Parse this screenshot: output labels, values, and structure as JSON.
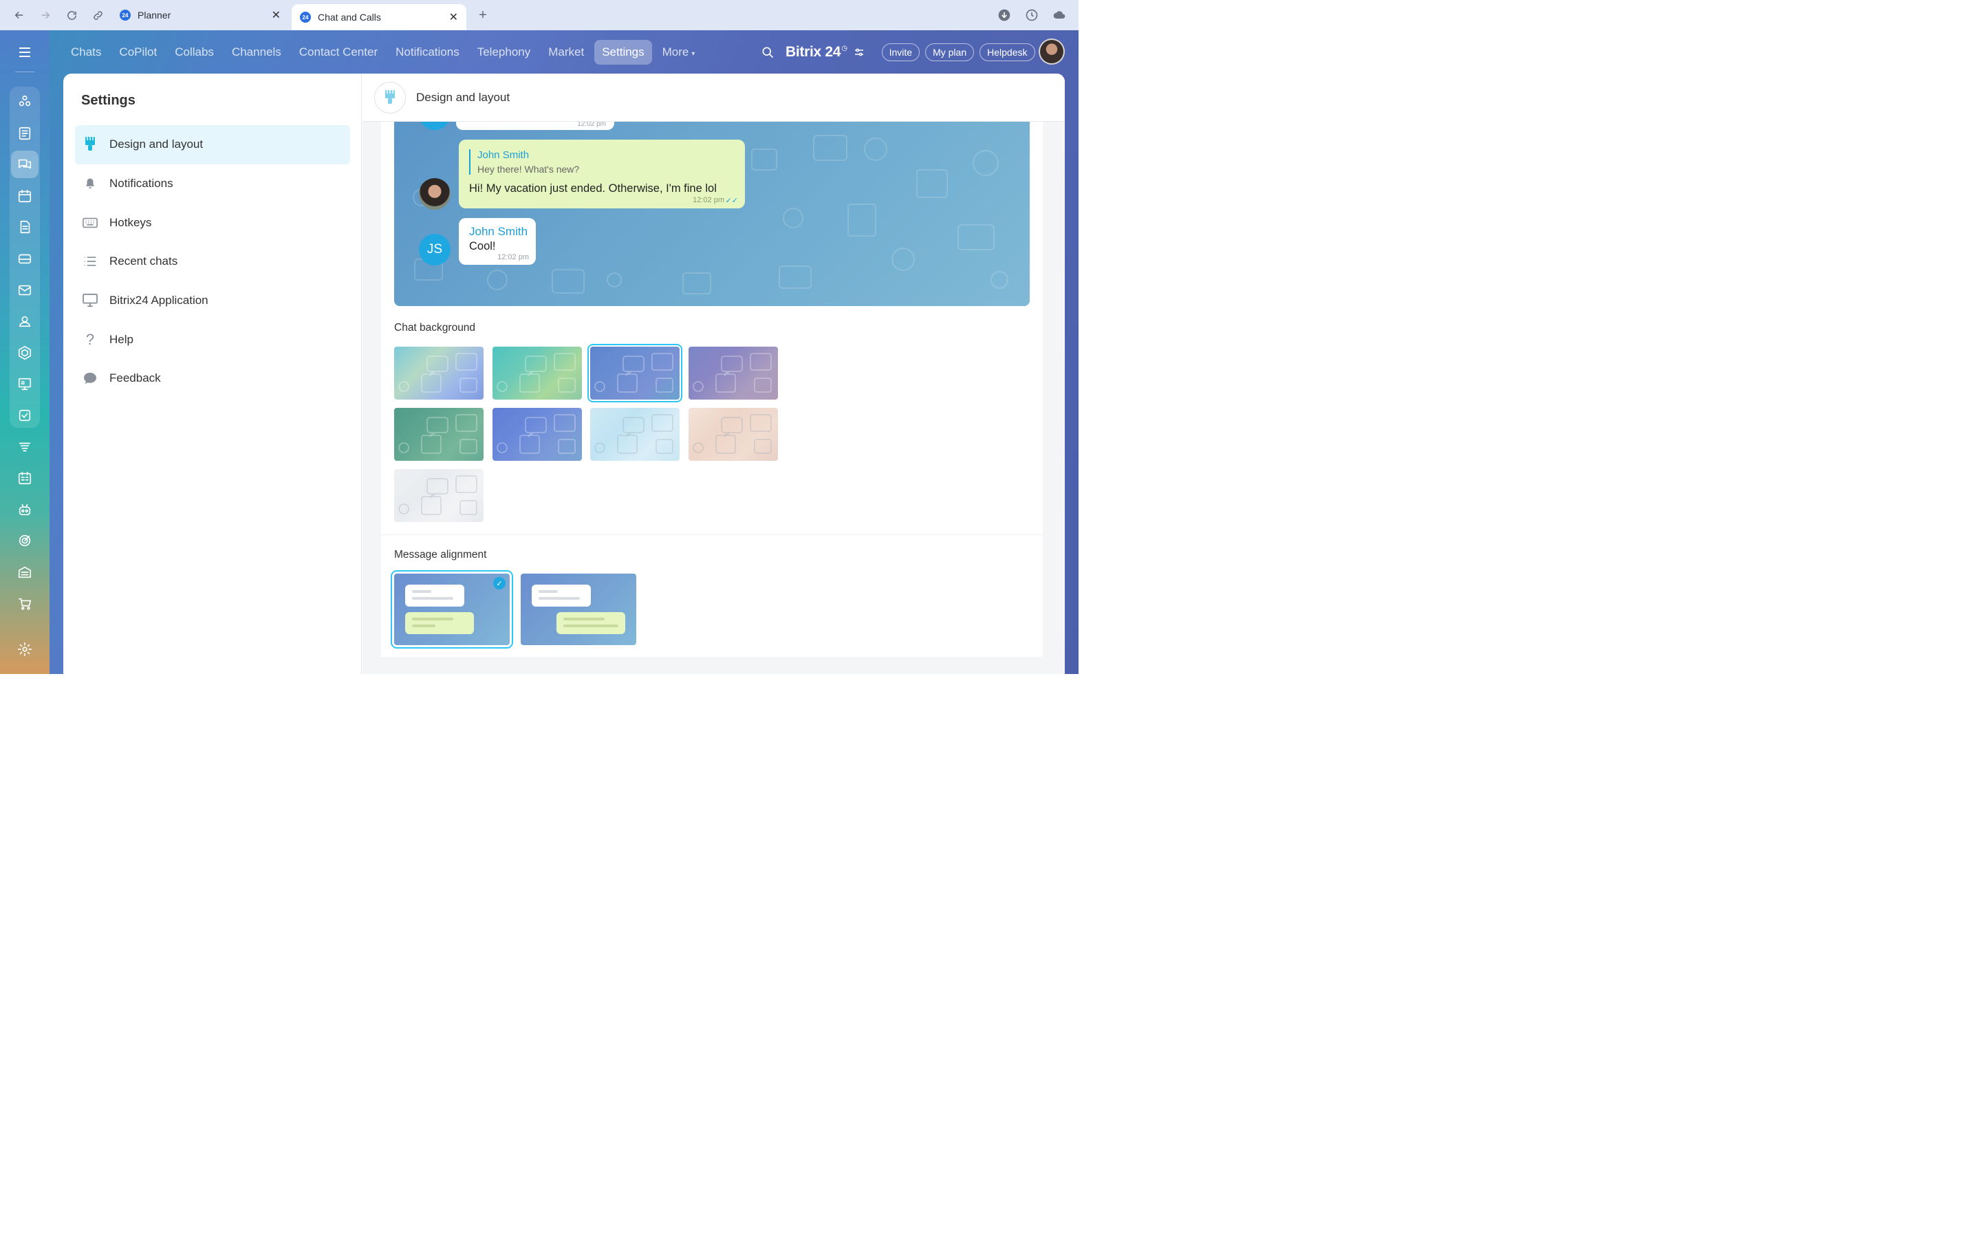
{
  "browser": {
    "tabs": [
      {
        "title": "Planner",
        "favicon": "24",
        "active": false
      },
      {
        "title": "Chat and Calls",
        "favicon": "24",
        "active": true
      }
    ],
    "new_tab_label": "+",
    "close_label": "✕"
  },
  "top_nav": {
    "items": [
      "Chats",
      "CoPilot",
      "Collabs",
      "Channels",
      "Contact Center",
      "Notifications",
      "Telephony",
      "Market",
      "Settings"
    ],
    "active": "Settings",
    "more_label": "More"
  },
  "header": {
    "logo": "Bitrix 24",
    "buttons": [
      "Invite",
      "My plan",
      "Helpdesk"
    ]
  },
  "rail": {
    "icons": [
      "copilot-icon",
      "feed-icon",
      "chat-icon",
      "calendar-icon",
      "documents-icon",
      "drive-icon",
      "mail-icon",
      "groups-icon",
      "crm-icon",
      "sites-icon",
      "tasks-icon",
      "automation-icon",
      "booking-icon",
      "robots-icon",
      "goals-icon",
      "inventory-icon",
      "shop-icon",
      "settings-icon"
    ],
    "active": "chat-icon"
  },
  "settings": {
    "title": "Settings",
    "menu": [
      {
        "label": "Design and layout",
        "icon": "brush-icon",
        "active": true
      },
      {
        "label": "Notifications",
        "icon": "bell-icon",
        "active": false
      },
      {
        "label": "Hotkeys",
        "icon": "keyboard-icon",
        "active": false
      },
      {
        "label": "Recent chats",
        "icon": "list-icon",
        "active": false
      },
      {
        "label": "Bitrix24 Application",
        "icon": "monitor-icon",
        "active": false
      },
      {
        "label": "Help",
        "icon": "question-icon",
        "active": false
      },
      {
        "label": "Feedback",
        "icon": "speech-bubble-icon",
        "active": false
      }
    ]
  },
  "content": {
    "title": "Design and layout",
    "preview": {
      "top_time": "12:02 pm",
      "quote_name": "John Smith",
      "quote_text": "Hey there! What's new?",
      "my_message": "Hi! My vacation just ended. Otherwise, I'm fine lol",
      "my_time": "12:02 pm",
      "other_initials": "JS",
      "other_name": "John Smith",
      "other_message": "Cool!",
      "other_time": "12:02 pm"
    },
    "chat_background_label": "Chat background",
    "backgrounds": [
      {
        "name": "pastel-gradient",
        "colors": [
          "#7ccad8",
          "#b5d9c5",
          "#9cb7ea",
          "#7f9be0"
        ],
        "selected": false
      },
      {
        "name": "teal-green",
        "colors": [
          "#4fc4c0",
          "#6ccab7",
          "#a9d89c",
          "#8cc9a5"
        ],
        "selected": false
      },
      {
        "name": "blue-purple",
        "colors": [
          "#5c86cf",
          "#6a8dd2",
          "#7b93d5",
          "#6aa3cf"
        ],
        "selected": true
      },
      {
        "name": "violet-mauve",
        "colors": [
          "#7b86c9",
          "#8a86c4",
          "#a99cbf",
          "#b09ab8"
        ],
        "selected": false
      },
      {
        "name": "forest-green",
        "colors": [
          "#4f9c88",
          "#5fa690",
          "#77b69a",
          "#66aa95"
        ],
        "selected": false
      },
      {
        "name": "royal-blue",
        "colors": [
          "#5f7ed6",
          "#6a88da",
          "#7b9ad8",
          "#7aa5d2"
        ],
        "selected": false
      },
      {
        "name": "light-sky",
        "colors": [
          "#cfe9f5",
          "#bfe3f3",
          "#d9eef7",
          "#c8e6f2"
        ],
        "selected": false
      },
      {
        "name": "peach",
        "colors": [
          "#f3e4da",
          "#eed5c8",
          "#f1dcd1",
          "#e8cfc6"
        ],
        "selected": false
      },
      {
        "name": "light-gray",
        "colors": [
          "#eef0f3",
          "#e9ecef",
          "#f2f3f5",
          "#e6e9ed"
        ],
        "selected": false
      }
    ],
    "message_alignment_label": "Message alignment",
    "alignments": [
      {
        "name": "left-alignment",
        "selected": true
      },
      {
        "name": "split-alignment",
        "selected": false
      }
    ]
  }
}
